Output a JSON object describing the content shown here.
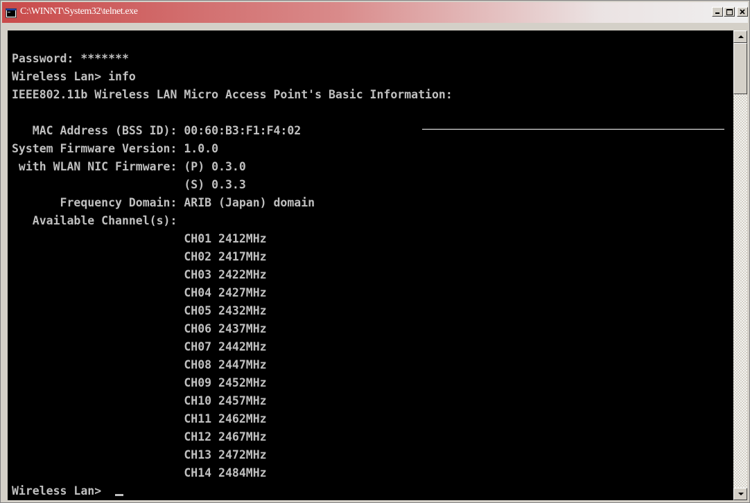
{
  "window": {
    "title": "C:\\WINNT\\System32\\telnet.exe",
    "app_icon": "console-icon",
    "controls": {
      "minimize_icon": "minimize-icon",
      "maximize_icon": "maximize-icon",
      "close_icon": "close-icon"
    },
    "title_gradient_start": "#c94a4a"
  },
  "terminal": {
    "background_color": "#000000",
    "text_color": "#c0c0c0",
    "password_line": "Password: *******",
    "prompt_command": "Wireless Lan> info",
    "heading": "IEEE802.11b Wireless LAN Micro Access Point's Basic Information:",
    "info": [
      {
        "label": "   MAC Address (BSS ID): ",
        "value": "00:60:B3:F1:F4:02"
      },
      {
        "label": "System Firmware Version: ",
        "value": "1.0.0"
      },
      {
        "label": " with WLAN NIC Firmware: ",
        "value": "(P) 0.3.0"
      },
      {
        "label": "                         ",
        "value": "(S) 0.3.3"
      },
      {
        "label": "       Frequency Domain: ",
        "value": "ARIB (Japan) domain"
      },
      {
        "label": "   Available Channel(s):",
        "value": ""
      }
    ],
    "channels": [
      {
        "channel": "CH01",
        "frequency": "2412MHz"
      },
      {
        "channel": "CH02",
        "frequency": "2417MHz"
      },
      {
        "channel": "CH03",
        "frequency": "2422MHz"
      },
      {
        "channel": "CH04",
        "frequency": "2427MHz"
      },
      {
        "channel": "CH05",
        "frequency": "2432MHz"
      },
      {
        "channel": "CH06",
        "frequency": "2437MHz"
      },
      {
        "channel": "CH07",
        "frequency": "2442MHz"
      },
      {
        "channel": "CH08",
        "frequency": "2447MHz"
      },
      {
        "channel": "CH09",
        "frequency": "2452MHz"
      },
      {
        "channel": "CH10",
        "frequency": "2457MHz"
      },
      {
        "channel": "CH11",
        "frequency": "2462MHz"
      },
      {
        "channel": "CH12",
        "frequency": "2467MHz"
      },
      {
        "channel": "CH13",
        "frequency": "2472MHz"
      },
      {
        "channel": "CH14",
        "frequency": "2484MHz"
      }
    ],
    "final_prompt": "Wireless Lan> "
  },
  "scrollbar": {
    "up_icon": "scroll-up-arrow-icon",
    "down_icon": "scroll-down-arrow-icon"
  }
}
